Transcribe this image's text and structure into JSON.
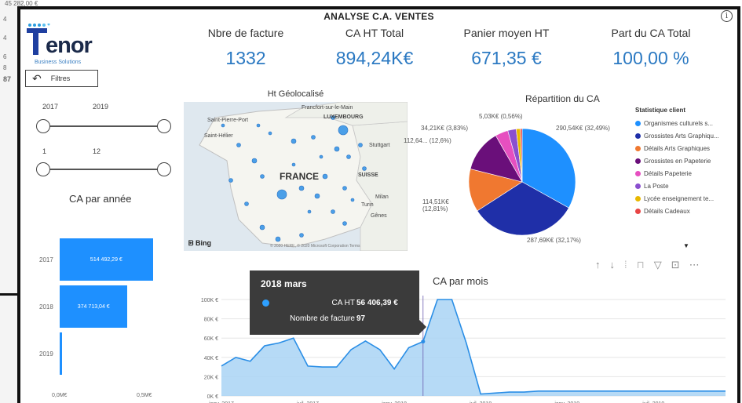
{
  "background": {
    "fragments": [
      "45 282,00 €",
      "4,62%",
      "4",
      "4",
      "6",
      "8",
      "87"
    ]
  },
  "report": {
    "title": "ANALYSE C.A. VENTES",
    "info_icon": "info-icon",
    "logo": {
      "text": "enor",
      "subtitle": "Business Solutions"
    },
    "filters_label": "Filtres",
    "kpis": [
      {
        "label": "Nbre de facture",
        "value": "1332"
      },
      {
        "label": "CA HT Total",
        "value": "894,24K€"
      },
      {
        "label": "Panier moyen HT",
        "value": "671,35 €"
      },
      {
        "label": "Part du CA Total",
        "value": "100,00 %"
      }
    ],
    "year_slider": {
      "from": "2017",
      "to": "2019"
    },
    "month_slider": {
      "from": "1",
      "to": "12"
    },
    "annual": {
      "title": "CA par année",
      "bars": [
        {
          "year": "2017",
          "label": "514 492,29 €",
          "value": 514492.29
        },
        {
          "year": "2018",
          "label": "374 713,04 €",
          "value": 374713.04
        },
        {
          "year": "2019",
          "label": "",
          "value": 5000
        }
      ],
      "axis": [
        "0,0M€",
        "0,5M€"
      ],
      "max": 520000
    },
    "map": {
      "title": "Ht Géolocalisé",
      "labels": [
        "Saint-Pierre-Port",
        "Saint-Hélier",
        "Francfort-sur-le-Main",
        "LUXEMBOURG",
        "Stuttgart",
        "FRANCE",
        "SUISSE",
        "Milan",
        "Turin",
        "Gênes"
      ],
      "bing": "Bing",
      "copyright": "© 2020 HERE, © 2020 Microsoft Corporation  Terms"
    },
    "pie": {
      "title": "Répartition du CA",
      "legend_title": "Statistique client",
      "slices": [
        {
          "name": "Organismes culturels s...",
          "value": 32.49,
          "label": "290,54K€ (32,49%)",
          "color": "#1e90ff"
        },
        {
          "name": "Grossistes Arts Graphiqu...",
          "value": 32.17,
          "label": "287,69K€ (32,17%)",
          "color": "#1f2fa8"
        },
        {
          "name": "Détails Arts Graphiques",
          "value": 12.81,
          "label": "114,51K€ (12,81%)",
          "color": "#f07830"
        },
        {
          "name": "Grossistes en Papeterie",
          "value": 12.6,
          "label": "112,64... (12,6%)",
          "color": "#6a0f7a"
        },
        {
          "name": "Détails Papeterie",
          "value": 3.83,
          "label": "34,21K€ (3,83%)",
          "color": "#e64fc0"
        },
        {
          "name": "La Poste",
          "value": 2.5,
          "label": "",
          "color": "#8a4fcf"
        },
        {
          "name": "Lycée enseignement te...",
          "value": 1.2,
          "label": "",
          "color": "#e8b800"
        },
        {
          "name": "Détails Cadeaux",
          "value": 0.56,
          "label": "5,03K€ (0,56%)",
          "color": "#e84545"
        }
      ]
    },
    "toolbar_icons": [
      "arrow-up-icon",
      "arrow-down-icon",
      "expand-down-icon",
      "drill-icon",
      "filter-icon",
      "focus-icon",
      "more-icon"
    ],
    "monthly": {
      "title": "CA par mois",
      "y_ticks": [
        "0K €",
        "20K €",
        "40K €",
        "60K €",
        "80K €",
        "100K €"
      ],
      "x_ticks": [
        "janv. 2017",
        "juil. 2017",
        "janv. 2018",
        "juil. 2018",
        "janv. 2019",
        "juil. 2019"
      ]
    },
    "tooltip": {
      "title": "2018 mars",
      "ca_label": "CA HT",
      "ca_value": "56 406,39 €",
      "count_label": "Nombre de facture",
      "count_value": "97"
    }
  },
  "chart_data": [
    {
      "type": "bar",
      "title": "CA par année",
      "categories": [
        "2017",
        "2018",
        "2019"
      ],
      "values": [
        514492.29,
        374713.04,
        5000
      ],
      "xlim": [
        0,
        500000
      ]
    },
    {
      "type": "pie",
      "title": "Répartition du CA",
      "categories": [
        "Organismes culturels s...",
        "Grossistes Arts Graphiqu...",
        "Détails Arts Graphiques",
        "Grossistes en Papeterie",
        "Détails Papeterie",
        "La Poste",
        "Lycée enseignement te...",
        "Détails Cadeaux"
      ],
      "values": [
        32.49,
        32.17,
        12.81,
        12.6,
        3.83,
        2.5,
        1.2,
        0.56
      ]
    },
    {
      "type": "area",
      "title": "CA par mois",
      "x": [
        "janv. 2017",
        "févr. 2017",
        "mars 2017",
        "avr. 2017",
        "mai 2017",
        "juin 2017",
        "juil. 2017",
        "août 2017",
        "sept. 2017",
        "oct. 2017",
        "nov. 2017",
        "déc. 2017",
        "janv. 2018",
        "févr. 2018",
        "mars 2018",
        "avr. 2018",
        "mai 2018",
        "juin 2018",
        "juil. 2018",
        "août 2018",
        "sept. 2018",
        "oct. 2018",
        "nov. 2018",
        "déc. 2018",
        "janv. 2019",
        "févr. 2019",
        "mars 2019",
        "avr. 2019",
        "mai 2019",
        "juin 2019",
        "juil. 2019",
        "août 2019",
        "sept. 2019",
        "oct. 2019",
        "nov. 2019",
        "déc. 2019"
      ],
      "values": [
        31000,
        40000,
        36000,
        52000,
        55000,
        60000,
        31000,
        30000,
        30000,
        48000,
        57000,
        48000,
        28000,
        50000,
        56406.39,
        100000,
        100000,
        55000,
        2000,
        3000,
        4000,
        4000,
        5000,
        5000,
        5000,
        5000,
        5000,
        5000,
        5000,
        5000,
        5000,
        5000,
        5000,
        5000,
        5000,
        5000
      ],
      "ylim": [
        0,
        100000
      ]
    }
  ]
}
